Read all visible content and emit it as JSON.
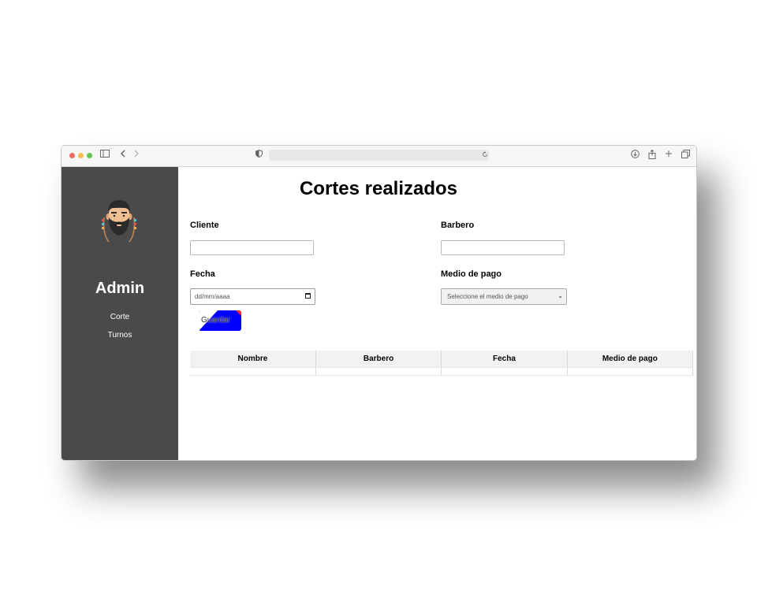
{
  "sidebar": {
    "title": "Admin",
    "nav": [
      {
        "label": "Corte"
      },
      {
        "label": "Turnos"
      }
    ]
  },
  "main": {
    "title": "Cortes realizados",
    "form": {
      "cliente_label": "Cliente",
      "cliente_value": "",
      "barbero_label": "Barbero",
      "barbero_value": "",
      "fecha_label": "Fecha",
      "fecha_placeholder": "dd/mm/aaaa",
      "medio_label": "Medio de pago",
      "medio_selected": "Seleccione el medio de pago",
      "save_label": "Guardar"
    },
    "table": {
      "columns": [
        "Nombre",
        "Barbero",
        "Fecha",
        "Medio de pago"
      ],
      "rows": []
    }
  },
  "colors": {
    "sidebar_bg": "#4a4a4a",
    "button_bg": "#0000ff",
    "header_bg": "#f2f2f2"
  },
  "icons": [
    "sidebar-toggle-icon",
    "back-icon",
    "forward-icon",
    "shield-icon",
    "reload-icon",
    "download-icon",
    "share-icon",
    "new-tab-icon",
    "tabs-overview-icon",
    "calendar-icon",
    "chevron-down-icon"
  ]
}
